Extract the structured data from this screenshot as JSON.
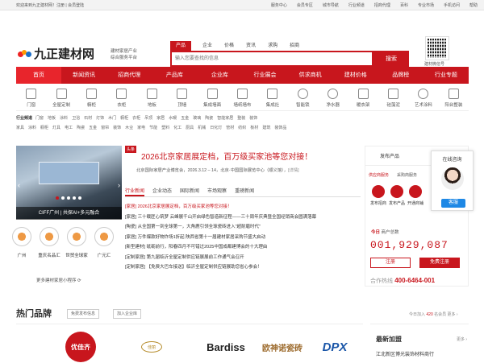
{
  "topbar": {
    "welcome": "欢迎来到九正建材网！注册 | 会员登陆",
    "links": [
      "服务中心",
      "会员专区",
      "城市导航",
      "行业频道",
      "招商代理",
      "百科",
      "专业市场",
      "手机访问",
      "帮助"
    ]
  },
  "header": {
    "logo_text": "九正建材网",
    "slogan_1": "建材家居产业",
    "slogan_2": "综合服务平台",
    "search_tabs": [
      "产品",
      "企业",
      "价格",
      "资讯",
      "求购",
      "招商"
    ],
    "search_placeholder": "输入您要查找的信息",
    "search_button": "搜索",
    "hot_words": "热门搜索：瓷砖  地板  卫浴  涂料  橱柜  门窗  吊顶  灯饰",
    "qr_label": "建材微信号"
  },
  "nav": [
    "首页",
    "新闻资讯",
    "招商代理",
    "产品库",
    "企业库",
    "行业展会",
    "供求商机",
    "建材价格",
    "品牌榜",
    "行业专题"
  ],
  "categories": [
    "门窗",
    "全屋定制",
    "橱柜",
    "衣柜",
    "地板",
    "顶墙",
    "集成墙面",
    "墙纸墙布",
    "集成灶",
    "智能锁",
    "净水器",
    "暖衣架",
    "硅藻泥",
    "艺术涂料",
    "阳台整装"
  ],
  "subcats": {
    "row1_title": "行业频道",
    "row1": [
      "门窗",
      "地板",
      "涂料",
      "卫浴",
      "石材",
      "灯饰",
      "木门",
      "橱柜",
      "衣柜",
      "吊顶",
      "家居",
      "水暖",
      "五金",
      "玻璃",
      "陶瓷",
      "智能家居",
      "整装",
      "装饰"
    ],
    "row2": [
      "家具",
      "涂料",
      "橱柜",
      "灯具",
      "电工",
      "陶瓷",
      "五金",
      "窗帘",
      "装饰",
      "木业",
      "家电",
      "节能",
      "塑料",
      "化工",
      "厨具",
      "机械",
      "日化灯",
      "管材",
      "纺织",
      "板材",
      "建筑",
      "装饰品"
    ]
  },
  "banner": {
    "caption": "CIFF广州 | 共探AI+多元融合"
  },
  "minis": [
    {
      "label": "广州"
    },
    {
      "label": "重庆名品汇"
    },
    {
      "label": "世贸全球家"
    },
    {
      "label": "广元汇"
    }
  ],
  "minis_link": "更多建材家居小程序 ⟳",
  "headline": {
    "tag": "头条",
    "title": "2026北京家居展定档，百万级买家池等您对接！",
    "summary": "北京国际家居产业博览会，2026.3.12 – 14，北京·中国国际展览中心（顺义馆），",
    "summary_more": "[详情]"
  },
  "news_tabs": [
    "行业新闻",
    "企业动态",
    "国际新闻",
    "市场观察",
    "重磅新闻"
  ],
  "news": [
    "[家居] 2026北京家居展定档，百万级买家池等您对接！",
    "[家居] 三十载匠心筑梦 云峰展千山开启绿色智造新征程——三十周年庆典暨全国经销商会圆满落幕",
    "[陶瓷] 从全国第一到全球第一，大角鹿引领全球瓷砖进入\"超耐磨时代\"",
    "[家居] 万件爆款好物炸场1折起 陕西省第十一届建材家居采购节盛大启动",
    "[新型建材] 砥砺前行，阳春四月不可错过2025中国成都建博会的十大理由",
    "[定制家居] 第九届临沂全屋定制供应链展展前工作通气会召开",
    "[定制家居] 【免费大巴车接送】临沂全屋定制供应链展助您省心参会！"
  ],
  "side": {
    "publish": "发布产品",
    "tabs": [
      "供应商服务",
      "采购商服务"
    ],
    "icons": [
      "发布招商",
      "发布产品",
      "开通商铺"
    ],
    "today_label": "今日",
    "today_value": "商户总数",
    "counter": "001,929,087",
    "register": "注册",
    "free": "免费注册",
    "hotline_label": "合作热线",
    "hotline": "400-6464-001"
  },
  "chat": {
    "title": "在线咨询",
    "button": "客服"
  },
  "brands_section": {
    "title": "热门品牌",
    "btn1": "免费发布信息",
    "btn2": "加入企业库",
    "today_join": "今日加入",
    "today_count": "420",
    "today_unit": "名会员  更多 ›",
    "brand_names": [
      "优佳齐",
      "佳丽",
      "Bardiss",
      "欧神诺瓷砖",
      "DPX"
    ]
  },
  "latest": {
    "title": "最新加盟",
    "more": "更多 ›",
    "item": "江北新区博光装饰材料商行"
  },
  "colors": {
    "brand_red": "#c8161d",
    "nav_active": "#e8252c",
    "chat_blue": "#1e88e5"
  }
}
